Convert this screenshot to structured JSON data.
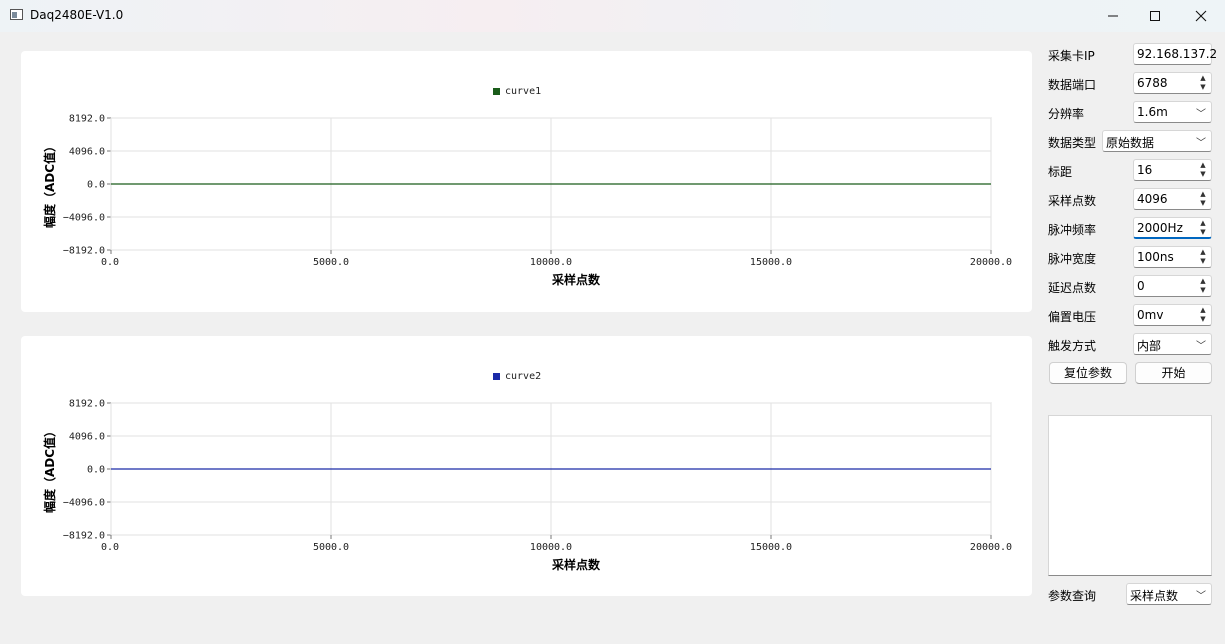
{
  "window": {
    "title": "Daq2480E-V1.0",
    "minimize_icon": "minimize-icon",
    "maximize_icon": "maximize-icon",
    "close_icon": "close-icon"
  },
  "charts": [
    {
      "legend": "curve1",
      "series_color": "#1a5c1a",
      "ylabel": "幅度（ADC值）",
      "xlabel": "采样点数",
      "ytick_labels": [
        "8192.0",
        "4096.0",
        "0.0",
        "−4096.0",
        "−8192.0"
      ],
      "xtick_labels": [
        "0.0",
        "5000.0",
        "10000.0",
        "15000.0",
        "20000.0"
      ]
    },
    {
      "legend": "curve2",
      "series_color": "#1a2aa8",
      "ylabel": "幅度（ADC值）",
      "xlabel": "采样点数",
      "ytick_labels": [
        "8192.0",
        "4096.0",
        "0.0",
        "−4096.0",
        "−8192.0"
      ],
      "xtick_labels": [
        "0.0",
        "5000.0",
        "10000.0",
        "15000.0",
        "20000.0"
      ]
    }
  ],
  "chart_data": [
    {
      "type": "line",
      "xlabel": "采样点数",
      "ylabel": "幅度（ADC值）",
      "xlim": [
        0,
        20000
      ],
      "ylim": [
        -8192,
        8192
      ],
      "grid": true,
      "legend_position": "top-center",
      "series": [
        {
          "name": "curve1",
          "x": [
            0,
            20000
          ],
          "y": [
            0,
            0
          ],
          "color": "#1a5c1a"
        }
      ]
    },
    {
      "type": "line",
      "xlabel": "采样点数",
      "ylabel": "幅度（ADC值）",
      "xlim": [
        0,
        20000
      ],
      "ylim": [
        -8192,
        8192
      ],
      "grid": true,
      "legend_position": "top-center",
      "series": [
        {
          "name": "curve2",
          "x": [
            0,
            20000
          ],
          "y": [
            0,
            0
          ],
          "color": "#1a2aa8"
        }
      ]
    }
  ],
  "params": {
    "ip_label": "采集卡IP",
    "ip_value": "92.168.137.2",
    "port_label": "数据端口",
    "port_value": "6788",
    "resolution_label": "分辨率",
    "resolution_value": "1.6m",
    "datatype_label": "数据类型",
    "datatype_value": "原始数据",
    "gauge_label": "标距",
    "gauge_value": "16",
    "samples_label": "采样点数",
    "samples_value": "4096",
    "pulse_freq_label": "脉冲频率",
    "pulse_freq_value": "2000Hz",
    "pulse_width_label": "脉冲宽度",
    "pulse_width_value": "100ns",
    "delay_label": "延迟点数",
    "delay_value": "0",
    "bias_label": "偏置电压",
    "bias_value": "0mv",
    "trigger_label": "触发方式",
    "trigger_value": "内部",
    "reset_button": "复位参数",
    "start_button": "开始",
    "query_label": "参数查询",
    "query_value": "采样点数"
  }
}
